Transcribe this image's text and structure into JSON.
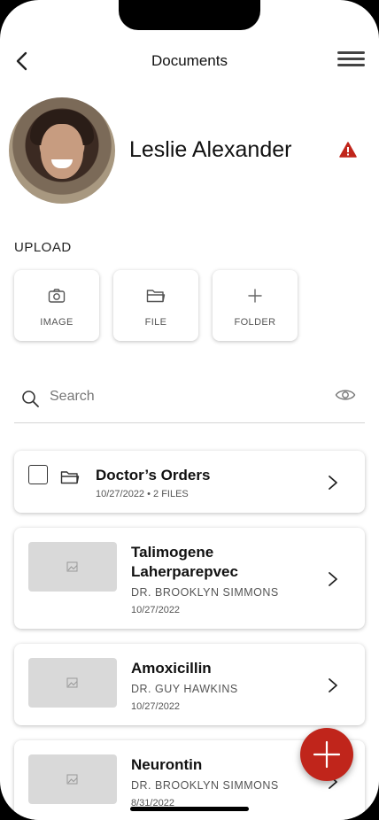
{
  "header": {
    "title": "Documents"
  },
  "profile": {
    "name": "Leslie Alexander",
    "status_color": "#c0251b"
  },
  "upload": {
    "label": "UPLOAD",
    "buttons": [
      {
        "label": "IMAGE",
        "icon": "camera-icon"
      },
      {
        "label": "FILE",
        "icon": "folder-icon"
      },
      {
        "label": "FOLDER",
        "icon": "plus-icon"
      }
    ]
  },
  "search": {
    "placeholder": "Search",
    "value": ""
  },
  "documents": [
    {
      "type": "folder",
      "title": "Doctor’s Orders",
      "meta": "10/27/2022 • 2 FILES"
    },
    {
      "type": "file",
      "title_line1": "Talimogene",
      "title_line2": "Laherparepvec",
      "doctor": "DR. BROOKLYN SIMMONS",
      "date": "10/27/2022"
    },
    {
      "type": "file",
      "title": "Amoxicillin",
      "doctor": "DR. GUY HAWKINS",
      "date": "10/27/2022"
    },
    {
      "type": "file",
      "title": "Neurontin",
      "doctor": "DR. BROOKLYN SIMMONS",
      "date": "8/31/2022"
    }
  ],
  "colors": {
    "accent": "#c0251b",
    "thumbnail": "#d9d9d9"
  }
}
